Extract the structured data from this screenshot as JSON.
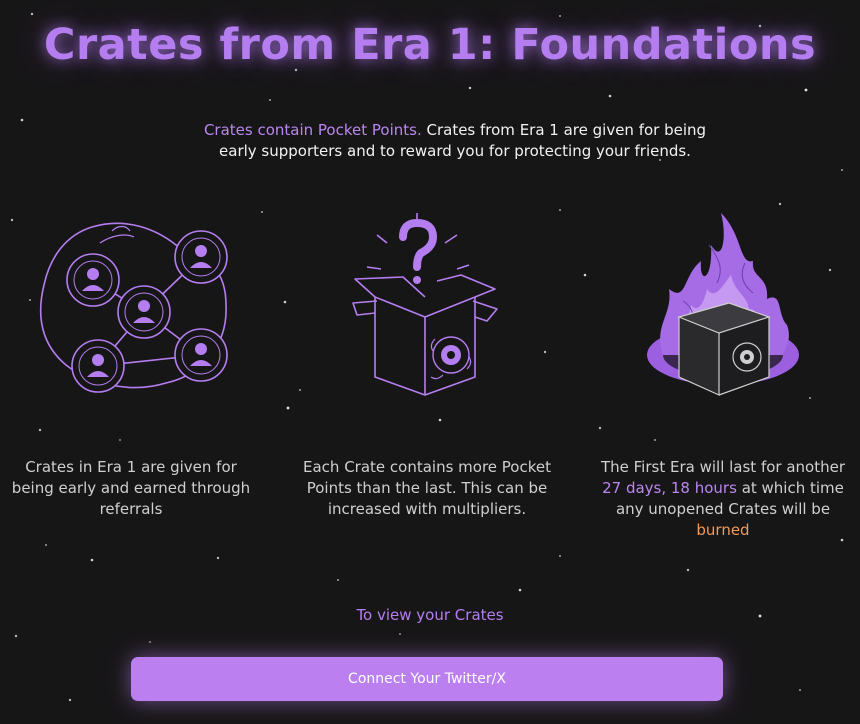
{
  "header": {
    "title": "Crates from Era 1: Foundations"
  },
  "intro": {
    "highlight": "Crates contain Pocket Points.",
    "text": " Crates from Era 1 are given for being early supporters and to reward you for protecting your friends."
  },
  "features": [
    {
      "icon": "referral-network-icon",
      "text": "Crates in Era 1 are given for being early and earned through referrals"
    },
    {
      "icon": "mystery-crate-icon",
      "text": "Each Crate contains more Pocket Points than the last. This can be increased with multipliers."
    },
    {
      "icon": "burning-crate-icon",
      "text_before": "The First Era will last for another ",
      "countdown": "27 days, 18 hours",
      "text_middle": " at which time any unopened Crates will be ",
      "burned": "burned"
    }
  ],
  "cta": {
    "label": "To view your Crates",
    "button": "Connect Your Twitter/X"
  },
  "colors": {
    "background": "#171617",
    "accent": "#b57ef0",
    "button": "#bb7ff0",
    "burned": "#f39a57"
  }
}
